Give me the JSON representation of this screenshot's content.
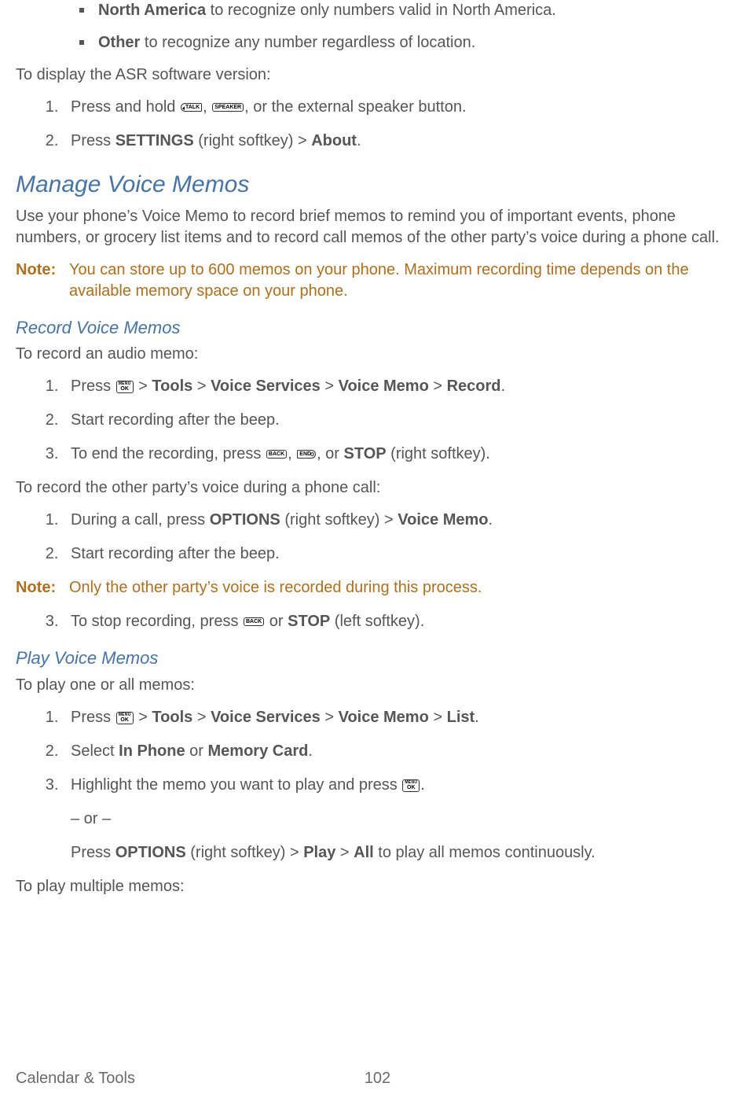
{
  "bullets": {
    "north_america_bold": "North America",
    "north_america_rest": " to recognize only numbers valid in North America.",
    "other_bold": "Other",
    "other_rest": " to recognize any number regardless of location."
  },
  "asr_intro": "To display the ASR software version:",
  "keys": {
    "talk": "TALK",
    "speaker": "SPEAKER",
    "menu_top": "MENU",
    "ok": "OK",
    "back": "BACK",
    "end": "END"
  },
  "asr_steps": {
    "s1_a": "Press and hold ",
    "s1_b": ", ",
    "s1_c": ", or the external speaker button.",
    "s2_a": "Press ",
    "s2_settings": "SETTINGS",
    "s2_mid": " (right softkey) > ",
    "s2_about": "About",
    "s2_end": "."
  },
  "manage_heading": "Manage Voice Memos",
  "manage_intro": "Use your phone’s Voice Memo to record brief memos to remind you of important events, phone numbers, or grocery list items and to record call memos of the other party’s voice during a phone call.",
  "note_label": "Note:",
  "note1_text": "You can store up to 600 memos on your phone. Maximum recording time depends on the available memory space on your phone.",
  "record_heading": "Record Voice Memos",
  "record_intro": "To record an audio memo:",
  "record_steps": {
    "s1_a": "Press ",
    "s1_b": " > ",
    "tools": "Tools",
    "voice_services": "Voice Services",
    "voice_memo": "Voice Memo",
    "record_bold": "Record",
    "dot": ".",
    "s2": "Start recording after the beep.",
    "s3_a": "To end the recording, press ",
    "s3_b": ", ",
    "s3_c": ", or ",
    "stop": "STOP",
    "s3_d": " (right softkey)."
  },
  "during_call_intro": "To record the other party’s voice during a phone call:",
  "during_steps": {
    "s1_a": "During a call, press ",
    "options": "OPTIONS",
    "s1_b": " (right softkey) > ",
    "voice_memo": "Voice Memo",
    "dot": ".",
    "s2": "Start recording after the beep."
  },
  "note2_text": "Only the other party’s voice is recorded during this process.",
  "during_step3": {
    "a": "To stop recording, press ",
    "b": " or ",
    "stop": "STOP",
    "c": " (left softkey)."
  },
  "play_heading": "Play Voice Memos",
  "play_intro": "To play one or all memos:",
  "play_steps": {
    "s1_a": "Press ",
    "gt": " > ",
    "tools": "Tools",
    "voice_services": "Voice Services",
    "voice_memo": "Voice Memo",
    "list": "List",
    "dot": ".",
    "s2_a": "Select ",
    "in_phone": "In Phone",
    "s2_b": " or ",
    "memory_card": "Memory Card",
    "s3_a": "Highlight the memo you want to play and press ",
    "or_dash": "– or –",
    "s3b_a": "Press ",
    "options": "OPTIONS",
    "s3b_b": " (right softkey) > ",
    "play": "Play",
    "all": "All",
    "s3b_c": " to play all memos continuously."
  },
  "play_multiple_intro": "To play multiple memos:",
  "footer_left": "Calendar & Tools",
  "footer_center": "102"
}
